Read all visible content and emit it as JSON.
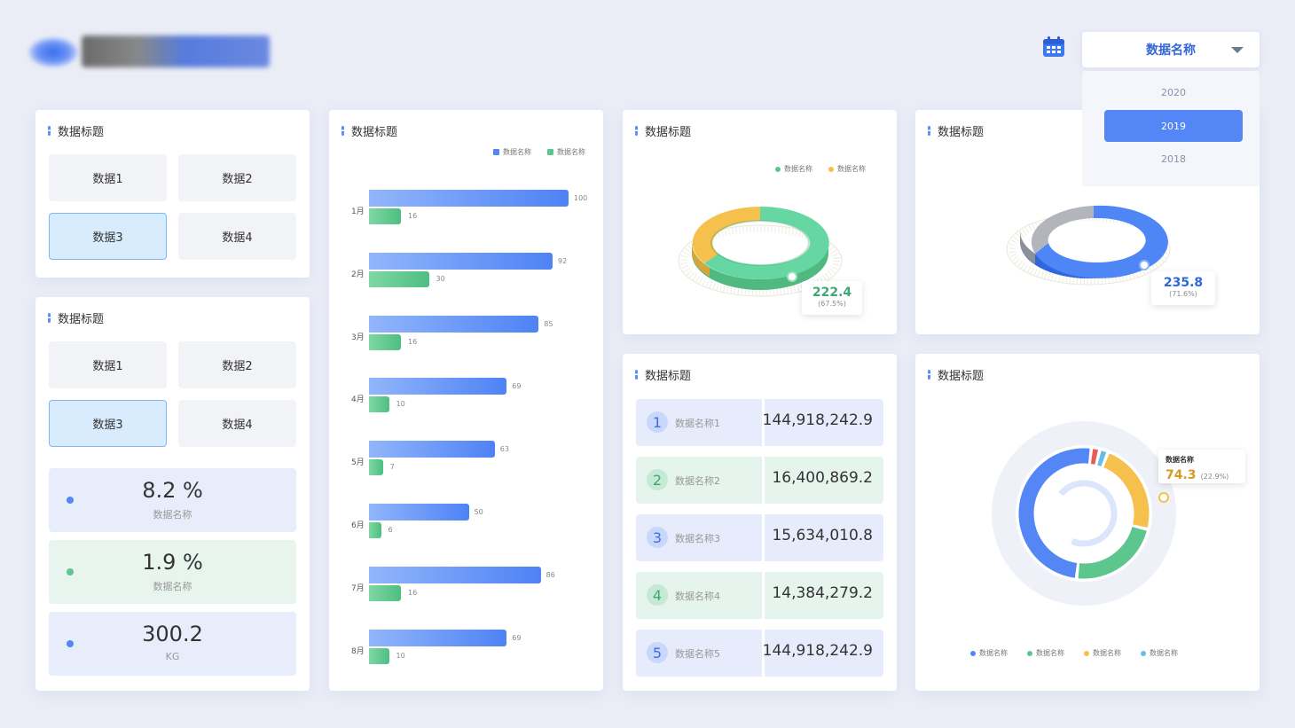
{
  "header": {
    "dropdown_label": "数据名称",
    "years": [
      "2020",
      "2019",
      "2018"
    ],
    "active_year": "2019"
  },
  "colors": {
    "blue": "#5486f5",
    "green": "#5cc68e",
    "yellow": "#f6c04c",
    "red": "#e95a5a",
    "cyan": "#6bbde6",
    "gray": "#a9adb6"
  },
  "panel1": {
    "title": "数据标题",
    "tiles": [
      "数据1",
      "数据2",
      "数据3",
      "数据4"
    ],
    "active_tile": "数据3"
  },
  "panel2": {
    "title": "数据标题",
    "tiles": [
      "数据1",
      "数据2",
      "数据3",
      "数据4"
    ],
    "active_tile": "数据3",
    "stats": [
      {
        "value": "8.2 %",
        "label": "数据名称",
        "color": "#5486f5"
      },
      {
        "value": "1.9 %",
        "label": "数据名称",
        "color": "#5cc68e"
      },
      {
        "value": "300.2",
        "label": "KG",
        "color": "#5486f5"
      }
    ]
  },
  "panel3": {
    "title": "数据标题",
    "legend": [
      "数据名称",
      "数据名称"
    ]
  },
  "chart_data": [
    {
      "type": "bar",
      "title": "数据标题",
      "orientation": "horizontal",
      "categories": [
        "1月",
        "2月",
        "3月",
        "4月",
        "5月",
        "6月",
        "7月",
        "8月"
      ],
      "series": [
        {
          "name": "数据名称",
          "values": [
            100,
            92,
            85,
            69,
            63,
            50,
            86,
            69
          ],
          "color": "#5486f5"
        },
        {
          "name": "数据名称",
          "values": [
            16,
            30,
            16,
            10,
            7,
            6,
            16,
            10
          ],
          "color": "#5cc68e"
        }
      ],
      "xlim": [
        0,
        100
      ],
      "legend_position": "top-right"
    },
    {
      "type": "pie",
      "title": "数据标题",
      "style": "3d-donut",
      "legend": [
        "数据名称",
        "数据名称"
      ],
      "slices": [
        {
          "color": "#5cc68e",
          "percent": 67.5
        },
        {
          "color": "#f6c04c",
          "percent": 32.5
        }
      ],
      "highlight": {
        "value": "222.4",
        "percent_label": "(67.5%)"
      }
    },
    {
      "type": "pie",
      "title": "数据标题",
      "style": "3d-donut",
      "slices": [
        {
          "color": "#3d7af2",
          "percent": 71.6
        },
        {
          "color": "#a9adb6",
          "percent": 28.4
        }
      ],
      "highlight": {
        "value": "235.8",
        "percent_label": "(71.6%)"
      }
    },
    {
      "type": "pie",
      "title": "数据标题",
      "style": "donut",
      "legend": [
        "数据名称",
        "数据名称",
        "数据名称",
        "数据名称"
      ],
      "legend_position": "bottom",
      "slices": [
        {
          "color": "#5486f5",
          "percent": 50
        },
        {
          "color": "#5cc68e",
          "percent": 22.9
        },
        {
          "color": "#f6c04c",
          "percent": 22.9
        },
        {
          "color": "#e95a5a",
          "percent": 2.1
        },
        {
          "color": "#6bbde6",
          "percent": 2.1
        }
      ],
      "highlight": {
        "name": "数据名称",
        "value": "74.3",
        "percent_label": "(22.9%)"
      }
    }
  ],
  "panel4": {
    "title": "数据标题",
    "legend": [
      "数据名称",
      "数据名称"
    ],
    "value": "222.4",
    "pct": "(67.5%)"
  },
  "panel5": {
    "title": "数据标题",
    "value": "235.8",
    "pct": "(71.6%)"
  },
  "panel6": {
    "title": "数据标题",
    "rows": [
      {
        "rank": "1",
        "name": "数据名称1",
        "value": "144,918,242.9",
        "theme": "blue"
      },
      {
        "rank": "2",
        "name": "数据名称2",
        "value": "16,400,869.2",
        "theme": "green"
      },
      {
        "rank": "3",
        "name": "数据名称3",
        "value": "15,634,010.8",
        "theme": "blue"
      },
      {
        "rank": "4",
        "name": "数据名称4",
        "value": "14,384,279.2",
        "theme": "green"
      },
      {
        "rank": "5",
        "name": "数据名称5",
        "value": "144,918,242.9",
        "theme": "blue"
      }
    ]
  },
  "panel7": {
    "title": "数据标题",
    "callout_name": "数据名称",
    "callout_value": "74.3",
    "callout_pct": "(22.9%)",
    "legend": [
      "数据名称",
      "数据名称",
      "数据名称",
      "数据名称"
    ]
  }
}
